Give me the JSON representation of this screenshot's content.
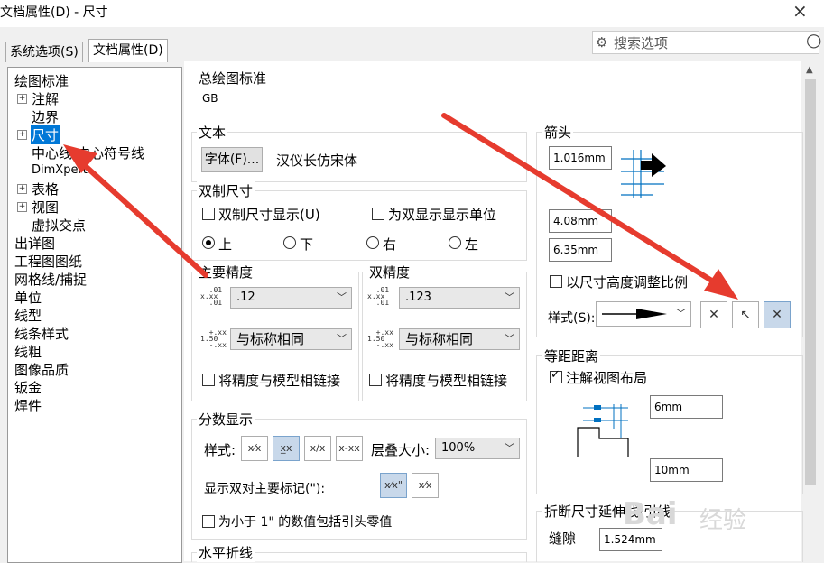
{
  "window": {
    "title": "文档属性(D) - 尺寸",
    "close": "×"
  },
  "tabs": [
    {
      "label": "系统选项(S)"
    },
    {
      "label": "文档属性(D)"
    }
  ],
  "search": {
    "placeholder": "搜索选项"
  },
  "tree": {
    "items": [
      "绘图标准",
      "注解",
      "边界",
      "尺寸",
      "中心线/中心符号线",
      "DimXpert",
      "表格",
      "视图",
      "虚拟交点",
      "出详图",
      "工程图图纸",
      "网格线/捕捉",
      "单位",
      "线型",
      "线条样式",
      "线粗",
      "图像品质",
      "钣金",
      "焊件"
    ]
  },
  "overall": {
    "title": "总绘图标准",
    "value": "GB"
  },
  "text": {
    "title": "文本",
    "font_button": "字体(F)...",
    "font_name": "汉仪长仿宋体"
  },
  "dual": {
    "title": "双制尺寸",
    "show": "双制尺寸显示(U)",
    "show_units": "为双显示显示单位",
    "radios": [
      "上",
      "下",
      "右",
      "左"
    ]
  },
  "primary_precision": {
    "title": "主要精度",
    "value1": ".12",
    "value2": "与标称相同",
    "link": "将精度与模型相链接"
  },
  "dual_precision": {
    "title": "双精度",
    "value1": ".123",
    "value2": "与标称相同",
    "link": "将精度与模型相链接"
  },
  "fraction": {
    "title": "分数显示",
    "style_label": "样式:",
    "stack_label": "层叠大小:",
    "stack_value": "100%",
    "double_prime": "显示双对主要标记(\"):",
    "leading_zero": "为小于 1\" 的数值包括引头零值"
  },
  "horizontal": {
    "title": "水平折线"
  },
  "arrows": {
    "title": "箭头",
    "val1": "1.016mm",
    "val2": "4.08mm",
    "val3": "6.35mm",
    "scale": "以尺寸高度调整比例",
    "style_label": "样式(S):"
  },
  "offset": {
    "title": "等距距离",
    "layout": "注解视图布局",
    "val1": "6mm",
    "val2": "10mm"
  },
  "break": {
    "title": "折断尺寸延伸线/引线",
    "gap_label": "缝隙",
    "gap_value": "1.524mm"
  },
  "watermark": {
    "text1": "Bai",
    "text2": "经验"
  },
  "colors": {
    "selection": "#0078d7",
    "arrow_red": "#e63b2e"
  }
}
